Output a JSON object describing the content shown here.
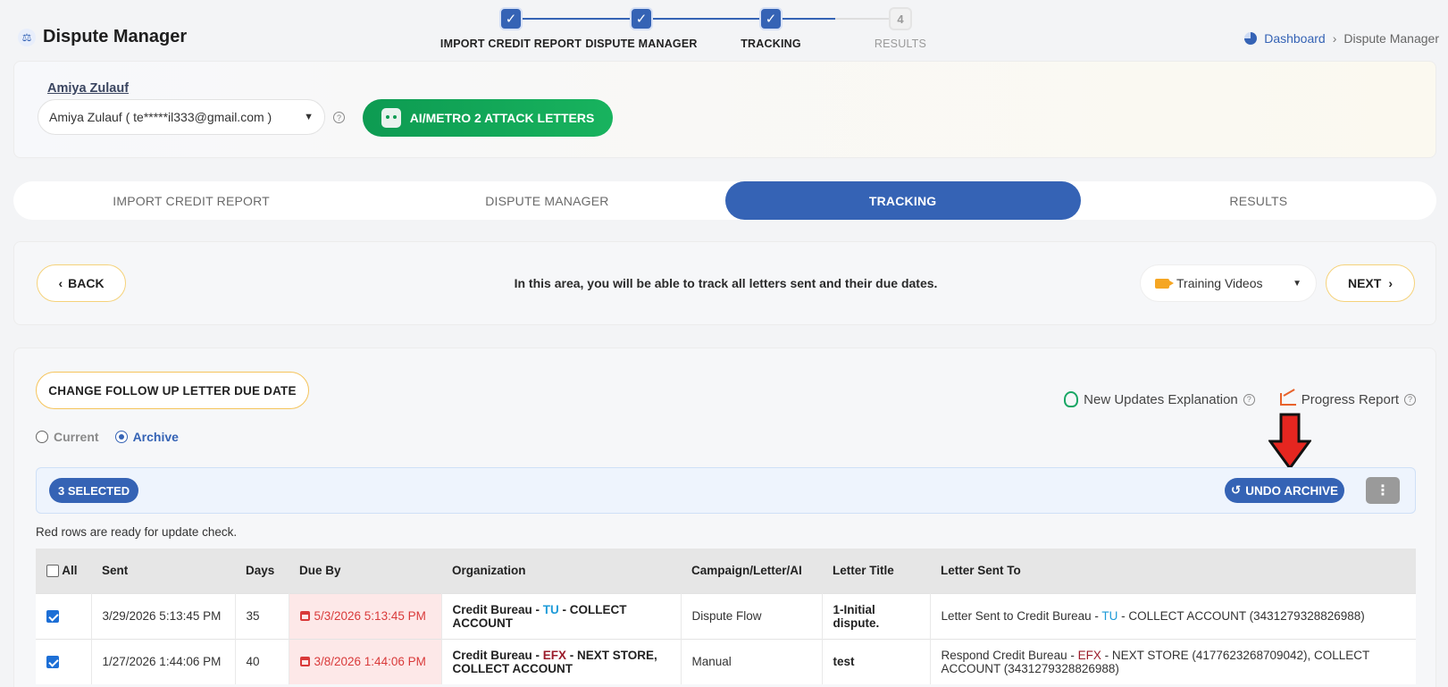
{
  "app": {
    "title": "Dispute Manager"
  },
  "stepper": {
    "steps": [
      {
        "label": "IMPORT CREDIT REPORT",
        "state": "done"
      },
      {
        "label": "DISPUTE MANAGER",
        "state": "done"
      },
      {
        "label": "TRACKING",
        "state": "done"
      },
      {
        "label": "RESULTS",
        "state": "pending",
        "number": "4"
      }
    ]
  },
  "breadcrumb": {
    "home": "Dashboard",
    "current": "Dispute Manager"
  },
  "client": {
    "name": "Amiya Zulauf",
    "select_value": "Amiya Zulauf ( te*****il333@gmail.com )",
    "ai_button": "AI/METRO 2 ATTACK LETTERS"
  },
  "tabs": [
    {
      "label": "IMPORT CREDIT REPORT",
      "active": false
    },
    {
      "label": "DISPUTE MANAGER",
      "active": false
    },
    {
      "label": "TRACKING",
      "active": true
    },
    {
      "label": "RESULTS",
      "active": false
    }
  ],
  "info": {
    "back": "BACK",
    "text": "In this area, you will be able to track all letters sent and their due dates.",
    "training": "Training Videos",
    "next": "NEXT"
  },
  "panel": {
    "followup_button": "CHANGE FOLLOW UP LETTER DUE DATE",
    "radio_current": "Current",
    "radio_archive": "Archive",
    "updates_link": "New Updates Explanation",
    "progress_link": "Progress Report",
    "selected_count": "3 SELECTED",
    "undo_archive": "UNDO ARCHIVE",
    "red_note": "Red rows are ready for update check."
  },
  "table": {
    "headers": [
      "All",
      "Sent",
      "Days",
      "Due By",
      "Organization",
      "Campaign/Letter/AI",
      "Letter Title",
      "Letter Sent To"
    ],
    "rows": [
      {
        "checked": true,
        "sent": "3/29/2026 5:13:45 PM",
        "days": "35",
        "due": "5/3/2026 5:13:45 PM",
        "org_prefix": "Credit Bureau - ",
        "org_bureau": "TU",
        "org_suffix": " - COLLECT ACCOUNT",
        "campaign": "Dispute Flow",
        "title": "1-Initial dispute.",
        "sent_to_prefix": "Letter Sent to Credit Bureau - ",
        "sent_to_bureau": "TU",
        "sent_to_suffix": " - COLLECT ACCOUNT (3431279328826988)"
      },
      {
        "checked": true,
        "sent": "1/27/2026 1:44:06 PM",
        "days": "40",
        "due": "3/8/2026 1:44:06 PM",
        "org_prefix": "Credit Bureau - ",
        "org_bureau": "EFX",
        "org_suffix": " - NEXT STORE, COLLECT ACCOUNT",
        "campaign": "Manual",
        "title": "test",
        "sent_to_prefix": "Respond Credit Bureau - ",
        "sent_to_bureau": "EFX",
        "sent_to_suffix": " - NEXT STORE (4177623268709042), COLLECT ACCOUNT (3431279328826988)"
      }
    ]
  },
  "colors": {
    "primary": "#3563b5",
    "green": "#0d9b52",
    "due_red": "#d93a3a",
    "tu": "#1e9bd8",
    "efx": "#9b1b2a"
  }
}
